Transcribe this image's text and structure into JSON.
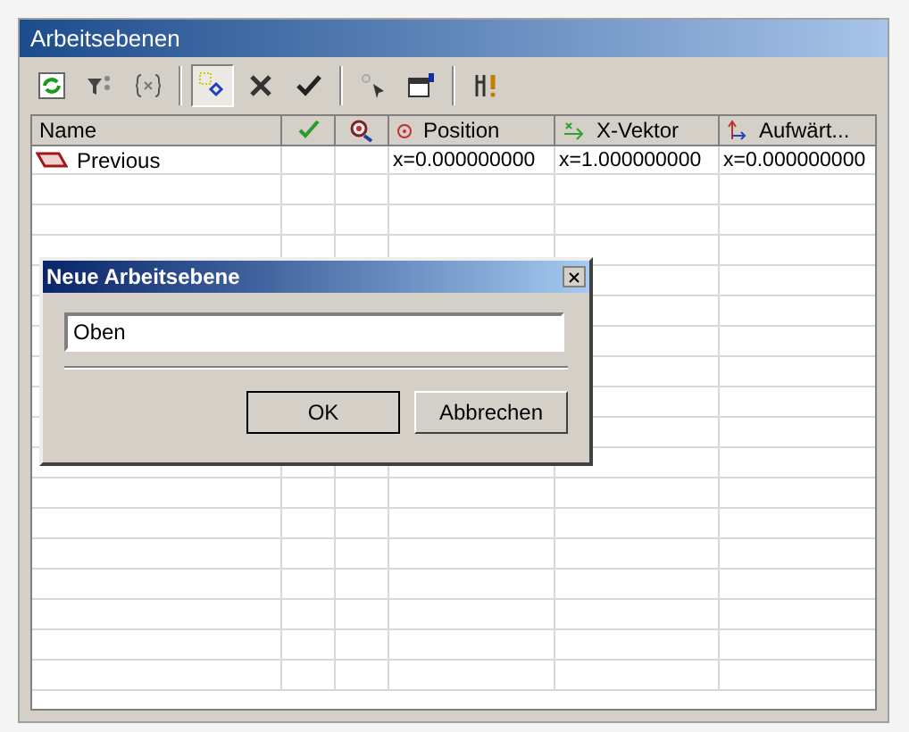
{
  "window": {
    "title": "Arbeitsebenen"
  },
  "toolbar": [
    {
      "kind": "refresh",
      "selected": false
    },
    {
      "kind": "filter",
      "selected": false
    },
    {
      "kind": "braces",
      "selected": false
    },
    {
      "kind": "sep"
    },
    {
      "kind": "points",
      "selected": true
    },
    {
      "kind": "delete",
      "selected": false
    },
    {
      "kind": "apply",
      "selected": false
    },
    {
      "kind": "sep"
    },
    {
      "kind": "pick",
      "selected": false
    },
    {
      "kind": "props",
      "selected": false
    },
    {
      "kind": "sep"
    },
    {
      "kind": "tools",
      "selected": false
    }
  ],
  "table": {
    "columns": [
      {
        "kind": "name",
        "label": "Name"
      },
      {
        "kind": "check"
      },
      {
        "kind": "zoom"
      },
      {
        "kind": "position",
        "label": "Position"
      },
      {
        "kind": "vector",
        "label": "X-Vektor"
      },
      {
        "kind": "up",
        "label": "Aufwärt..."
      }
    ],
    "rows": [
      {
        "name": "Previous",
        "column_4": "x=0.000000000",
        "column_5": "x=1.000000000",
        "column_6": "x=0.000000000"
      }
    ]
  },
  "dialog": {
    "title": "Neue Arbeitsebene",
    "value": "Oben",
    "buttons": [
      "OK",
      "Abbrechen"
    ]
  }
}
